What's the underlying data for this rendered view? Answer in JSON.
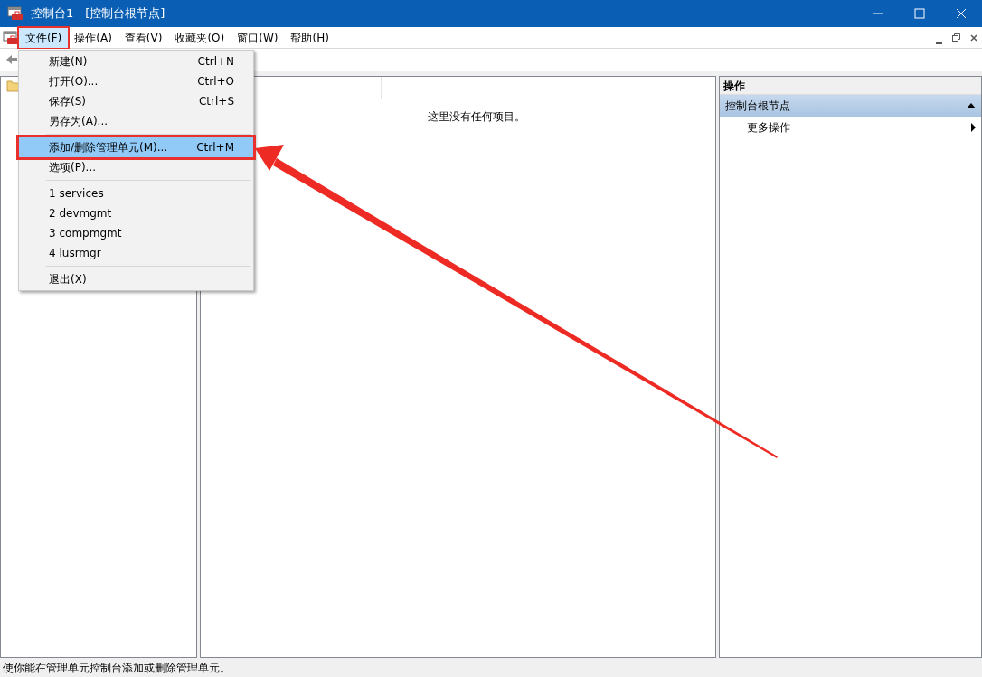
{
  "window": {
    "title": "控制台1 - [控制台根节点]"
  },
  "menubar": [
    {
      "label": "文件(F)",
      "selected": true,
      "highlighted": true
    },
    {
      "label": "操作(A)",
      "selected": false,
      "highlighted": false
    },
    {
      "label": "查看(V)",
      "selected": false,
      "highlighted": false
    },
    {
      "label": "收藏夹(O)",
      "selected": false,
      "highlighted": false
    },
    {
      "label": "窗口(W)",
      "selected": false,
      "highlighted": false
    },
    {
      "label": "帮助(H)",
      "selected": false,
      "highlighted": false
    }
  ],
  "file_menu": [
    {
      "kind": "item",
      "label": "新建(N)",
      "shortcut": "Ctrl+N",
      "selected": false,
      "highlighted": false
    },
    {
      "kind": "item",
      "label": "打开(O)...",
      "shortcut": "Ctrl+O",
      "selected": false,
      "highlighted": false
    },
    {
      "kind": "item",
      "label": "保存(S)",
      "shortcut": "Ctrl+S",
      "selected": false,
      "highlighted": false
    },
    {
      "kind": "item",
      "label": "另存为(A)...",
      "selected": false,
      "highlighted": false
    },
    {
      "kind": "separator"
    },
    {
      "kind": "item",
      "label": "添加/删除管理单元(M)...",
      "shortcut": "Ctrl+M",
      "selected": true,
      "highlighted": true
    },
    {
      "kind": "item",
      "label": "选项(P)...",
      "selected": false,
      "highlighted": false
    },
    {
      "kind": "separator"
    },
    {
      "kind": "item",
      "label": "1 services",
      "selected": false,
      "highlighted": false
    },
    {
      "kind": "item",
      "label": "2 devmgmt",
      "selected": false,
      "highlighted": false
    },
    {
      "kind": "item",
      "label": "3 compmgmt",
      "selected": false,
      "highlighted": false
    },
    {
      "kind": "item",
      "label": "4 lusrmgr",
      "selected": false,
      "highlighted": false
    },
    {
      "kind": "separator"
    },
    {
      "kind": "item",
      "label": "退出(X)",
      "selected": false,
      "highlighted": false
    }
  ],
  "content": {
    "empty_message": "这里没有任何项目。"
  },
  "actions_pane": {
    "title": "操作",
    "section": {
      "label": "控制台根节点",
      "expanded": true
    },
    "items": [
      {
        "label": "更多操作"
      }
    ]
  },
  "status_bar": {
    "text": "使你能在管理单元控制台添加或删除管理单元。"
  }
}
